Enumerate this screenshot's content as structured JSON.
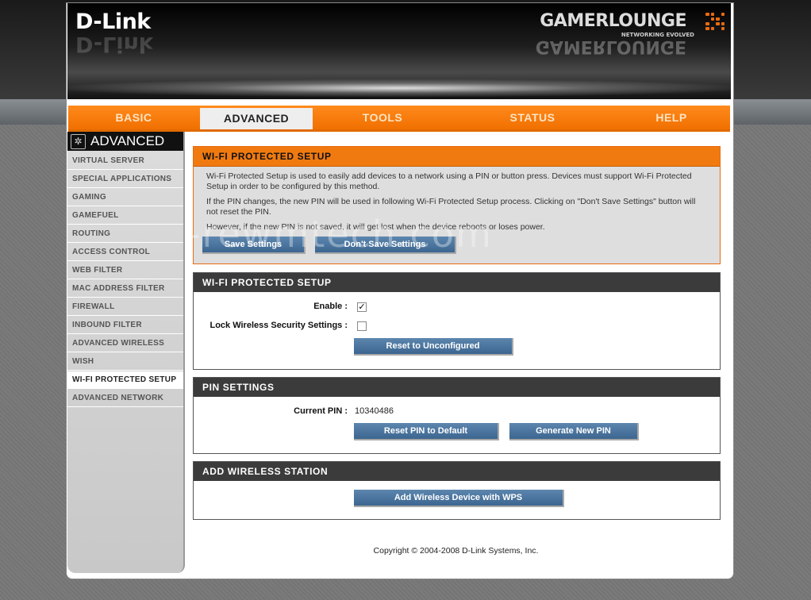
{
  "brand": {
    "logo": "D-Link",
    "gamer_logo": "GAMERLOUNGE",
    "gamer_tag": "NETWORKING EVOLVED"
  },
  "tabs": [
    {
      "label": "BASIC",
      "active": false
    },
    {
      "label": "ADVANCED",
      "active": true
    },
    {
      "label": "TOOLS",
      "active": false
    },
    {
      "label": "STATUS",
      "active": false
    },
    {
      "label": "HELP",
      "active": false
    }
  ],
  "sidebar": {
    "title": "ADVANCED",
    "items": [
      "VIRTUAL SERVER",
      "SPECIAL APPLICATIONS",
      "GAMING",
      "GAMEFUEL",
      "ROUTING",
      "ACCESS CONTROL",
      "WEB FILTER",
      "MAC ADDRESS FILTER",
      "FIREWALL",
      "INBOUND FILTER",
      "ADVANCED WIRELESS",
      "WISH",
      "WI-FI PROTECTED SETUP",
      "ADVANCED NETWORK"
    ],
    "active_index": 12
  },
  "intro": {
    "title": "WI-FI PROTECTED SETUP",
    "p1": "Wi-Fi Protected Setup is used to easily add devices to a network using a PIN or button press. Devices must support Wi-Fi Protected Setup in order to be configured by this method.",
    "p2": "If the PIN changes, the new PIN will be used in following Wi-Fi Protected Setup process. Clicking on \"Don't Save Settings\" button will not reset the PIN.",
    "p3": "However, if the new PIN is not saved, it will get lost when the device reboots or loses power.",
    "save_label": "Save Settings",
    "dont_save_label": "Don't Save Settings"
  },
  "wps": {
    "title": "WI-FI PROTECTED SETUP",
    "enable_label": "Enable :",
    "enable_checked": true,
    "lock_label": "Lock Wireless Security Settings :",
    "lock_checked": false,
    "reset_label": "Reset to Unconfigured"
  },
  "pin": {
    "title": "PIN SETTINGS",
    "current_label": "Current PIN :",
    "current_value": "10340486",
    "reset_label": "Reset PIN to Default",
    "generate_label": "Generate New PIN"
  },
  "station": {
    "title": "ADD WIRELESS STATION",
    "add_label": "Add Wireless Device with WPS"
  },
  "footer": {
    "copyright": "Copyright © 2004-2008 D-Link Systems, Inc."
  },
  "colors": {
    "accent": "#f07a10",
    "button": "#4a74a0",
    "title_bar": "#3b3b3b"
  }
}
